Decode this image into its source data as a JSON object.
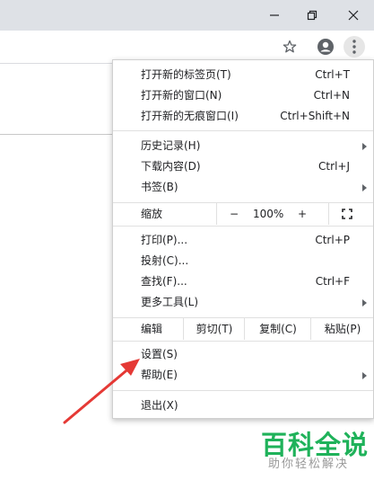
{
  "window_controls": {
    "minimize": "minimize-icon",
    "restore": "restore-icon",
    "close": "close-icon"
  },
  "toolbar": {
    "bookmark_icon": "star-icon",
    "profile_icon": "account-icon",
    "menu_icon": "vertical-dots-icon"
  },
  "menu": {
    "group1": [
      {
        "label": "打开新的标签页(T)",
        "shortcut": "Ctrl+T"
      },
      {
        "label": "打开新的窗口(N)",
        "shortcut": "Ctrl+N"
      },
      {
        "label": "打开新的无痕窗口(I)",
        "shortcut": "Ctrl+Shift+N"
      }
    ],
    "group2": [
      {
        "label": "历史记录(H)",
        "shortcut": ""
      },
      {
        "label": "下载内容(D)",
        "shortcut": "Ctrl+J"
      },
      {
        "label": "书签(B)",
        "shortcut": ""
      }
    ],
    "zoom": {
      "label": "缩放",
      "minus": "−",
      "value": "100%",
      "plus": "+",
      "fullscreen_icon": "fullscreen-icon"
    },
    "group3": [
      {
        "label": "打印(P)...",
        "shortcut": "Ctrl+P"
      },
      {
        "label": "投射(C)...",
        "shortcut": ""
      },
      {
        "label": "查找(F)...",
        "shortcut": "Ctrl+F"
      },
      {
        "label": "更多工具(L)",
        "shortcut": ""
      }
    ],
    "edit": {
      "label": "编辑",
      "cut": "剪切(T)",
      "copy": "复制(C)",
      "paste": "粘贴(P)"
    },
    "group4": [
      {
        "label": "设置(S)",
        "shortcut": ""
      },
      {
        "label": "帮助(E)",
        "shortcut": ""
      }
    ],
    "exit": {
      "label": "退出(X)"
    }
  },
  "annotation": {
    "color": "#e53935"
  },
  "watermark": {
    "title": "百科全说",
    "subtitle": "助你轻松解决",
    "color": "#1fb25a"
  }
}
